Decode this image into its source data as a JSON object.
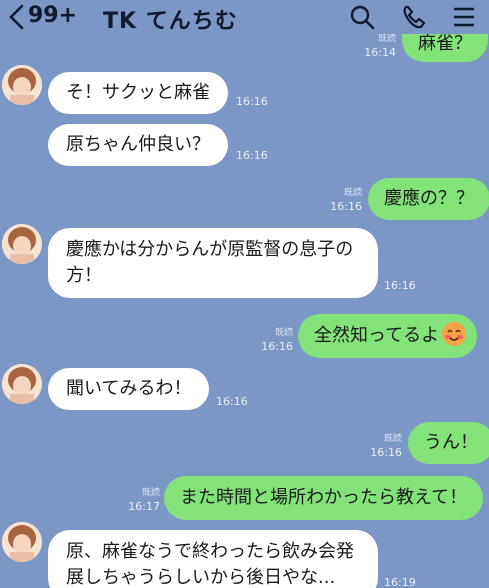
{
  "header": {
    "unread_count": "99+",
    "contact_name": "TK てんちむ",
    "icons": [
      "chevron-left-icon",
      "search-icon",
      "phone-icon",
      "menu-icon"
    ]
  },
  "colors": {
    "background": "#7b97c6",
    "incoming_bubble": "#ffffff",
    "outgoing_bubble": "#83e27a"
  },
  "messages": [
    {
      "direction": "out",
      "text": "麻雀？",
      "read": "既読",
      "time": "16:14"
    },
    {
      "direction": "in",
      "text": "そ！サクッと麻雀",
      "time": "16:16"
    },
    {
      "direction": "in",
      "text": "原ちゃん仲良い？",
      "time": "16:16"
    },
    {
      "direction": "out",
      "text": "慶應の？？",
      "read": "既読",
      "time": "16:16"
    },
    {
      "direction": "in",
      "text": "慶應かは分からんが原監督の息子の方！",
      "time": "16:16"
    },
    {
      "direction": "out",
      "text": "全然知ってるよ",
      "emoji": "smiling-face-emoji",
      "read": "既読",
      "time": "16:16"
    },
    {
      "direction": "in",
      "text": "聞いてみるわ！",
      "time": "16:16"
    },
    {
      "direction": "out",
      "text": "うん！",
      "read": "既読",
      "time": "16:16"
    },
    {
      "direction": "out",
      "text": "また時間と場所わかったら教えて！",
      "read": "既読",
      "time": "16:17"
    },
    {
      "direction": "in",
      "text": "原、麻雀なうで終わったら飲み会発展しちゃうらしいから後日やな...",
      "time": "16:19"
    }
  ]
}
